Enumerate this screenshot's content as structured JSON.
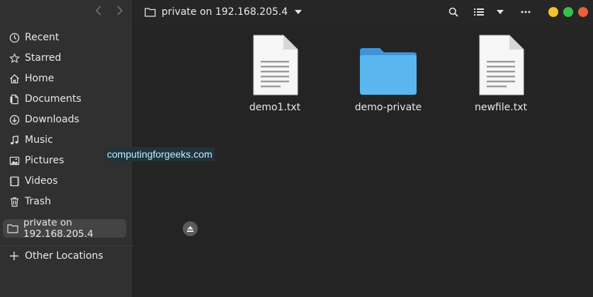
{
  "sidebar": {
    "items": [
      {
        "label": "Recent",
        "icon": "clock-icon"
      },
      {
        "label": "Starred",
        "icon": "star-icon"
      },
      {
        "label": "Home",
        "icon": "home-icon"
      },
      {
        "label": "Documents",
        "icon": "document-icon"
      },
      {
        "label": "Downloads",
        "icon": "download-icon"
      },
      {
        "label": "Music",
        "icon": "music-icon"
      },
      {
        "label": "Pictures",
        "icon": "picture-icon"
      },
      {
        "label": "Videos",
        "icon": "video-icon"
      },
      {
        "label": "Trash",
        "icon": "trash-icon"
      }
    ],
    "mount": {
      "label": "private on 192.168.205.4",
      "icon": "folder-icon",
      "active": true
    },
    "other": {
      "label": "Other Locations",
      "icon": "plus-icon"
    }
  },
  "header": {
    "path_label": "private on 192.168.205.4"
  },
  "files": [
    {
      "name": "demo1.txt",
      "type": "text-file"
    },
    {
      "name": "demo-private",
      "type": "folder"
    },
    {
      "name": "newfile.txt",
      "type": "text-file"
    }
  ],
  "watermark": "computingforgeeks.com",
  "colors": {
    "window_bg": "#242424",
    "sidebar_bg": "#303030",
    "folder_blue": "#59b6ee",
    "close": "#ec5f3f",
    "minimize": "#f5c32c",
    "maximize": "#35c24a"
  }
}
